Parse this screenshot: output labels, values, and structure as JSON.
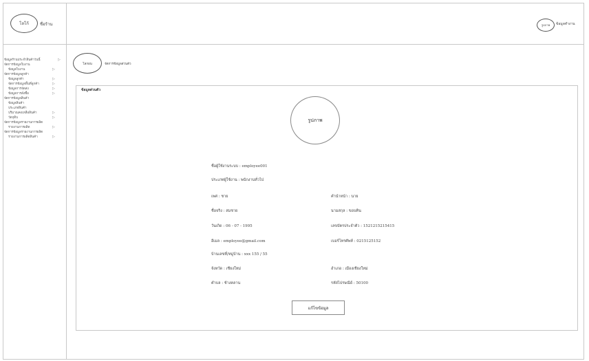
{
  "header": {
    "logo_oval": "โลโก้",
    "logo_text": "ชื่อร้าน",
    "user_oval": "รูปภาพ",
    "user_text": "ข้อมูลทำงาน"
  },
  "sidebar": {
    "items": [
      {
        "label": "ข้อมูลร้านประจำสินค้าวันนี้",
        "level": 1,
        "arrow": true
      },
      {
        "label": "จัดการข้อมูลใบงาน",
        "level": 1,
        "arrow": false
      },
      {
        "label": "ข้อมูลใบงาน",
        "level": 2,
        "arrow": true
      },
      {
        "label": "จัดการข้อมูลลูกค้า",
        "level": 1,
        "arrow": false
      },
      {
        "label": "ข้อมูลลูกค้า",
        "level": 2,
        "arrow": true
      },
      {
        "label": "จัดการข้อมูลพื้นที่ลูกค้า",
        "level": 2,
        "arrow": true
      },
      {
        "label": "ข้อมูลการจัดส่ง",
        "level": 2,
        "arrow": true
      },
      {
        "label": "ข้อมูลการสั่งซื้อ",
        "level": 2,
        "arrow": true
      },
      {
        "label": "จัดการข้อมูลสินค้า",
        "level": 1,
        "arrow": false
      },
      {
        "label": "ข้อมูลสินค้า",
        "level": 2,
        "arrow": false
      },
      {
        "label": "ประเภทสินค้า",
        "level": 2,
        "arrow": false
      },
      {
        "label": "ปริมาณคงเหลือสินค้า",
        "level": 2,
        "arrow": true
      },
      {
        "label": "วัตถุดิบ",
        "level": 2,
        "arrow": true
      },
      {
        "label": "จัดการข้อมูลรายงานการผลิต",
        "level": 1,
        "arrow": false
      },
      {
        "label": "รายงานการผลิต",
        "level": 2,
        "arrow": true
      },
      {
        "label": "จัดการข้อมูลรายงานการผลิต",
        "level": 1,
        "arrow": false
      },
      {
        "label": "รายงานการผลิตสินค้า",
        "level": 2,
        "arrow": true
      }
    ],
    "arrow_glyph": "▷"
  },
  "breadcrumb": {
    "oval": "โลกอน",
    "text": "จัดการข้อมูลส่วนตัว"
  },
  "card": {
    "title": "ข้อมูลส่วนตัว",
    "photo_label": "รูปภาพ"
  },
  "fields": {
    "username": "ชื่อผู้ใช้งานระบบ : employee001",
    "user_type": "ประเภทผู้ใช้งาน : พนักงานทั่วไป",
    "gender": "เพศ : ชาย",
    "prefix": "คำนำหน้า : นาย",
    "first_name": "ชื่อจริง : สมชาย",
    "last_name": "นามสกุล : ขอบคิน",
    "birthdate": "วันเกิด : 06 - 07 - 1995",
    "id_card": "เลขบัตรประจำตัว : 1521215215415",
    "email": "อีเมล : employee@gmail.com",
    "phone": "เบอร์โทรศัพท์ : 0215125152",
    "address": "บ้านเลขที่/หมู่บ้าน : xxx 155 / 55",
    "province": "จังหวัด : เชียงใหม่",
    "district": "อำเภอ : เมืองเชียงใหม่",
    "subdistrict": "ตำบล : ช้างคลาน",
    "postcode": "รหัสไปรษณีย์ : 50100"
  },
  "edit_button": "แก้ไขข้อมูล"
}
